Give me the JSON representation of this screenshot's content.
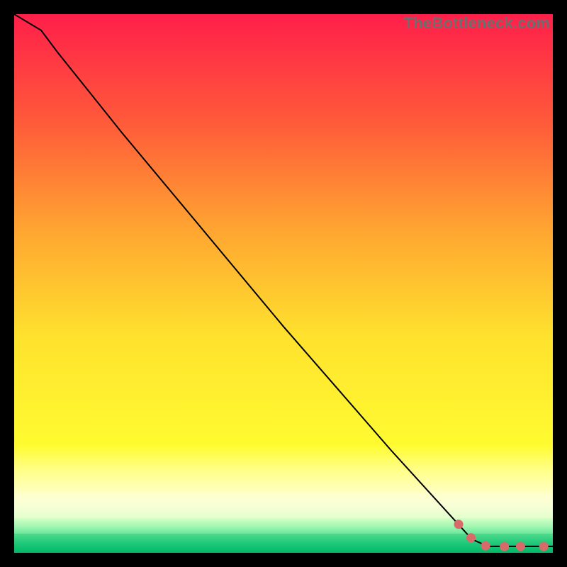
{
  "watermark": "TheBottleneck.com",
  "chart_data": {
    "type": "line",
    "title": "",
    "xlabel": "",
    "ylabel": "",
    "xlim": [
      0,
      100
    ],
    "ylim": [
      0,
      100
    ],
    "curve": [
      {
        "x": 0,
        "y": 100
      },
      {
        "x": 5,
        "y": 97
      },
      {
        "x": 8,
        "y": 93
      },
      {
        "x": 12,
        "y": 88
      },
      {
        "x": 20,
        "y": 78
      },
      {
        "x": 30,
        "y": 66
      },
      {
        "x": 40,
        "y": 54
      },
      {
        "x": 50,
        "y": 42
      },
      {
        "x": 60,
        "y": 30.5
      },
      {
        "x": 70,
        "y": 19
      },
      {
        "x": 80,
        "y": 8
      },
      {
        "x": 85,
        "y": 2.5
      },
      {
        "x": 88,
        "y": 1.2
      },
      {
        "x": 92,
        "y": 1.2
      },
      {
        "x": 100,
        "y": 1.2
      }
    ],
    "marker_segments": [
      {
        "x0": 62,
        "y0": 28.2,
        "x1": 67,
        "y1": 22.4
      },
      {
        "x0": 68,
        "y0": 21.3,
        "x1": 71.5,
        "y1": 17.25
      },
      {
        "x0": 72.3,
        "y0": 16.3,
        "x1": 75.2,
        "y1": 13.1
      },
      {
        "x0": 76.5,
        "y0": 11.8,
        "x1": 78.0,
        "y1": 10.1
      },
      {
        "x0": 79.0,
        "y0": 9.0,
        "x1": 80.3,
        "y1": 7.7
      }
    ],
    "marker_dots": [
      {
        "x": 82.5,
        "y": 5.3
      },
      {
        "x": 84.8,
        "y": 2.8
      },
      {
        "x": 87.5,
        "y": 1.3
      },
      {
        "x": 91.0,
        "y": 1.2
      },
      {
        "x": 94.0,
        "y": 1.2
      },
      {
        "x": 98.3,
        "y": 1.2
      }
    ],
    "background_bands": [
      {
        "top_pct": 0,
        "height_pct": 80,
        "gradient": [
          "#ff1f4a",
          "#ff5a3a",
          "#ffa531",
          "#ffe22e",
          "#fffb30"
        ]
      },
      {
        "top_pct": 80,
        "height_pct": 9,
        "gradient": [
          "#fffb30",
          "#ffff86",
          "#ffffc4"
        ]
      },
      {
        "top_pct": 89,
        "height_pct": 4.5,
        "gradient": [
          "#ffffcc",
          "#f8ffd6",
          "#e3ffce"
        ]
      },
      {
        "top_pct": 93.5,
        "height_pct": 3.0,
        "gradient": [
          "#d3ffc5",
          "#a7f7b4",
          "#6be89c"
        ]
      },
      {
        "top_pct": 96.5,
        "height_pct": 3.5,
        "gradient": [
          "#4fda8d",
          "#1fc979",
          "#00b867"
        ]
      }
    ]
  }
}
